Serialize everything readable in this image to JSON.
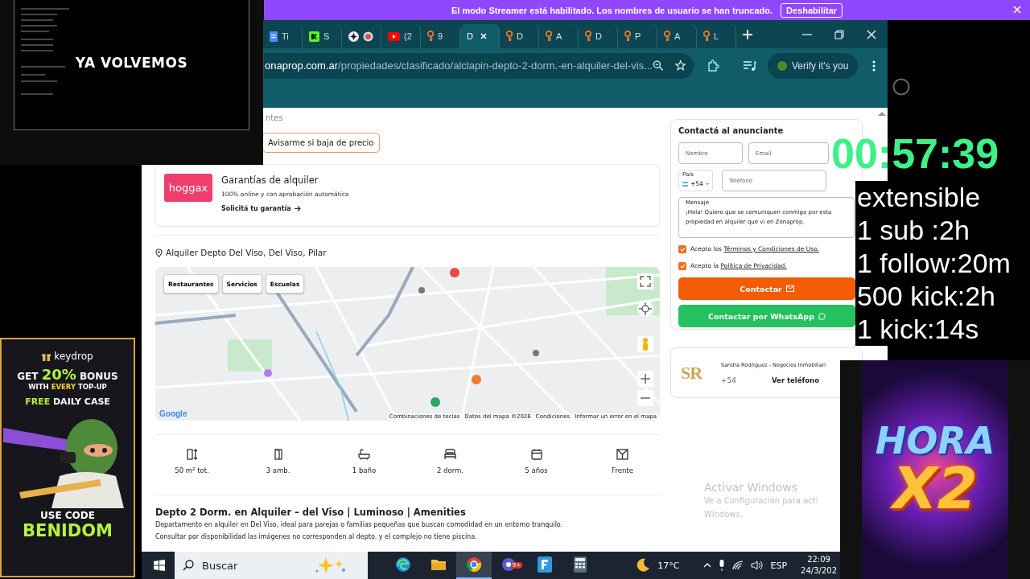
{
  "streamer_banner": {
    "message": "El modo Streamer está habilitado. Los nombres de usuario se han truncado.",
    "button": "Deshabilitar"
  },
  "break_screen": {
    "title": "YA VOLVEMOS"
  },
  "browser": {
    "tabs": [
      {
        "kind": "docs",
        "label": "Ti",
        "selected": false
      },
      {
        "kind": "kick",
        "label": "S",
        "selected": false
      },
      {
        "kind": "pinwheel",
        "selected": false
      },
      {
        "kind": "youtube",
        "label": "(2",
        "selected": false
      },
      {
        "kind": "key",
        "label": "9",
        "selected": false
      },
      {
        "kind": "none",
        "label": "D",
        "selected": true
      },
      {
        "kind": "key",
        "label": "D",
        "selected": false
      },
      {
        "kind": "key",
        "label": "A",
        "selected": false
      },
      {
        "kind": "key",
        "label": "D",
        "selected": false
      },
      {
        "kind": "key",
        "label": "P",
        "selected": false
      },
      {
        "kind": "key",
        "label": "A",
        "selected": false
      },
      {
        "kind": "key",
        "label": "L",
        "selected": false
      }
    ],
    "address": {
      "host": "onaprop.com.ar",
      "path": "/propiedades/clasificado/alclapin-depto-2-dorm.-en-alquiler-del-vis..."
    },
    "profile_chip": "Verify it's you"
  },
  "listing": {
    "breadcrumb_tail": "ntes",
    "price_alert_button": "Avisarme si baja de precio",
    "guarantee": {
      "logo": "hoggax",
      "title": "Garantías de alquiler",
      "subtitle": "100% online y con aprobación automática",
      "link": "Solicitá tu garantía"
    },
    "location": "Alquiler Depto Del Viso, Del Viso, Pilar",
    "map": {
      "chips": [
        "Restaurantes",
        "Servicios",
        "Escuelas"
      ],
      "logo": "Google",
      "attribution": [
        "Combinaciones de teclas",
        "Datos del mapa ©2026",
        "Condiciones",
        "Informar un error en el mapa"
      ]
    },
    "features": [
      {
        "kind": "area",
        "label": "50 m² tot."
      },
      {
        "kind": "rooms",
        "label": "3 amb."
      },
      {
        "kind": "bath",
        "label": "1 baño"
      },
      {
        "kind": "bed",
        "label": "2 dorm."
      },
      {
        "kind": "age",
        "label": "5 años"
      },
      {
        "kind": "orientation",
        "label": "Frente"
      }
    ],
    "title": "Depto 2 Dorm. en Alquiler – del Viso | Luminoso | Amenities",
    "description": [
      "Departamento en alquiler en Del Viso, ideal para parejas o familias pequeñas que buscan comodidad en un entorno tranquilo.",
      "Consultar por disponibilidad las imágenes no corresponden al depto. y el complejo no tiene piscina."
    ]
  },
  "contact_form": {
    "title": "Contactá al anunciante",
    "name": {
      "placeholder": "Nombre"
    },
    "email": {
      "placeholder": "Email"
    },
    "country": {
      "label": "País",
      "value": "+54"
    },
    "phone": {
      "placeholder": "Teléfono"
    },
    "message": {
      "label": "Mensaje",
      "value": "¡Hola! Quiero que se comuniquen conmigo por esta propiedad en alquiler que vi en Zonaprop."
    },
    "consents": [
      {
        "text": "Acepto los",
        "link": "Términos y Condiciones de Uso.",
        "checked": true
      },
      {
        "text": "Acepto la",
        "link": "Política de Privacidad.",
        "checked": true
      }
    ],
    "contact_button": "Contactar",
    "whatsapp_button": "Contactar por WhatsApp"
  },
  "advertiser": {
    "logo": "SR",
    "name": "Sandra Rodriguez - Negocios Inmobiliari",
    "phone": "+54",
    "phone_button": "Ver teléfono"
  },
  "activation_notice": {
    "title": "Activar Windows",
    "lines": [
      "Ve a Configuración para acti",
      "Windows."
    ]
  },
  "timer_overlay": {
    "time": "00:57:39",
    "lines": [
      "extensible",
      "1 sub :2h",
      "1 follow:20m",
      "500 kick:2h",
      "1 kick:14s"
    ]
  },
  "promo_left": {
    "brand": "keydrop",
    "lines": [
      "GET **20%** BONUS",
      "WITH **EVERY** TOP-UP",
      "**FREE** DAILY CASE"
    ],
    "code_label": "USE CODE",
    "code": "BENIDOM"
  },
  "promo_right": {
    "lines": [
      "HORA",
      "X2"
    ]
  },
  "taskbar": {
    "search_placeholder": "Buscar",
    "apps": [
      {
        "kind": "edge",
        "active": false
      },
      {
        "kind": "files",
        "active": false
      },
      {
        "kind": "chrome",
        "active": true
      },
      {
        "kind": "chat",
        "active": false,
        "badge": "9+"
      },
      {
        "kind": "fapp",
        "active": false
      },
      {
        "kind": "calculator",
        "active": false
      }
    ],
    "temperature": "17°C",
    "language": "ESP",
    "time": "22:09",
    "date": "24/3/202"
  }
}
